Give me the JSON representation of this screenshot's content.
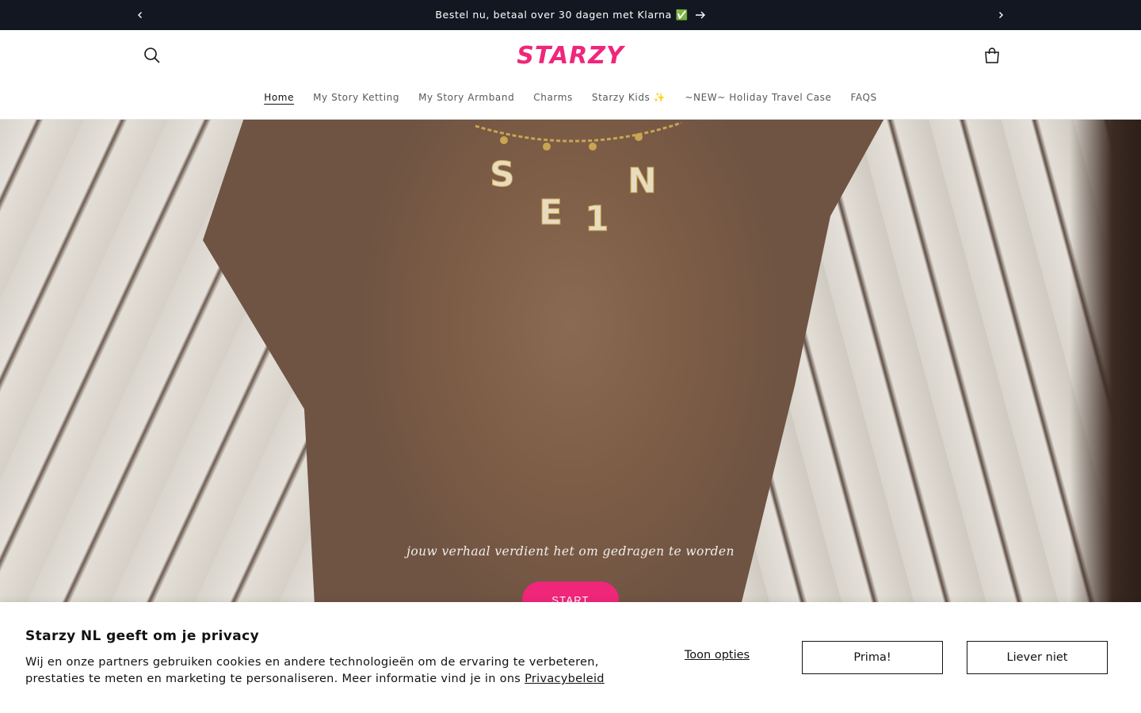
{
  "announcement": {
    "message": "Bestel nu, betaal over 30 dagen met Klarna ✅",
    "arrow": "→"
  },
  "header": {
    "logo": "STARZY",
    "nav": [
      {
        "label": "Home",
        "active": true
      },
      {
        "label": "My Story Ketting"
      },
      {
        "label": "My Story Armband"
      },
      {
        "label": "Charms"
      },
      {
        "label": "Starzy Kids ✨"
      },
      {
        "label": "~NEW~ Holiday Travel Case"
      },
      {
        "label": "FAQS"
      }
    ]
  },
  "hero": {
    "necklace_letters": [
      "S",
      "E",
      "1",
      "N"
    ],
    "tagline": "jouw verhaal verdient het om gedragen te worden",
    "cta": "START"
  },
  "cookie": {
    "title": "Starzy NL geeft om je privacy",
    "text": "Wij en onze partners gebruiken cookies en andere technologieën om de ervaring te verbeteren, prestaties te meten en marketing te personaliseren. Meer informatie vind je in ons ",
    "policy_link": "Privacybeleid",
    "options_label": "Toon opties",
    "accept_label": "Prima!",
    "decline_label": "Liever niet"
  },
  "colors": {
    "brand": "#f0267a",
    "announcement_bg": "#121722"
  }
}
